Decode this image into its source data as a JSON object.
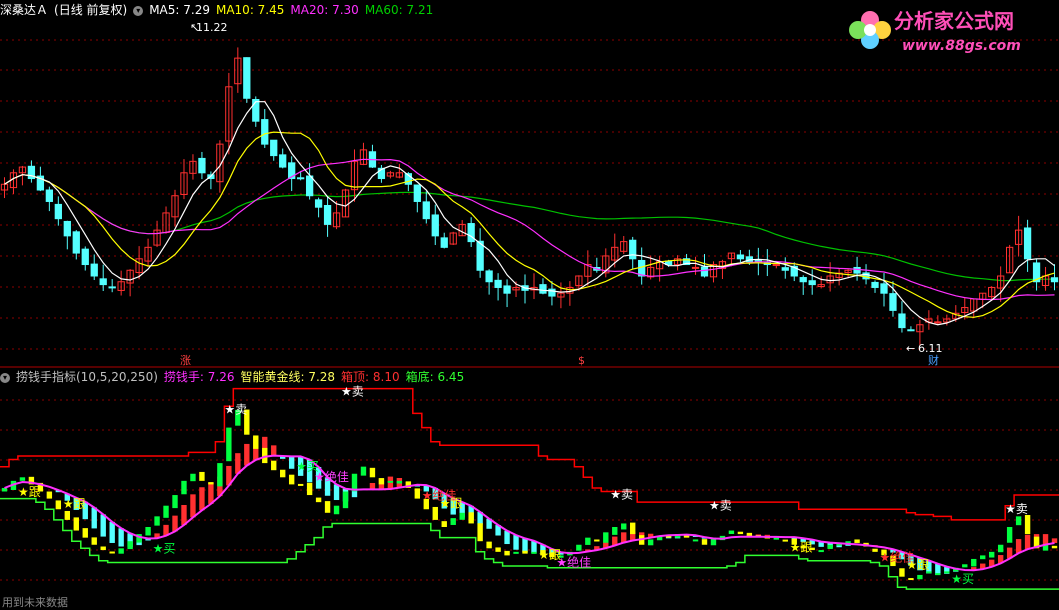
{
  "top_header": {
    "stock_name": "深桑达Ａ",
    "period": "(日线 前复权)",
    "ma5": "MA5: 7.29",
    "ma10": "MA10: 7.45",
    "ma20": "MA20: 7.30",
    "ma60": "MA60: 7.21"
  },
  "bottom_header": {
    "indicator_name": "捞钱手指标(10,5,20,250)",
    "lqs": "捞钱手: 7.26",
    "gold_line": "智能黄金线: 7.28",
    "box_top": "箱顶: 8.10",
    "box_bottom": "箱底: 6.45"
  },
  "watermark": {
    "title": "分析家公式网",
    "url": "www.88gs.com"
  },
  "markers": {
    "high_price": "11.22",
    "low_price": "6.11",
    "zhang": "涨",
    "dollar": "$",
    "cai": "财"
  },
  "signals": {
    "sell": "卖",
    "follow": "跟",
    "buy": "买",
    "absolute": "绝佳"
  },
  "footer_note": "用到未来数据",
  "colors": {
    "up": "#ff3030",
    "down": "#54ffff",
    "ma5": "#ffffff",
    "ma10": "#ffff00",
    "ma20": "#ff30ff",
    "ma60": "#00c000",
    "box_top": "#ff0000",
    "box_bottom": "#30ff30",
    "grid": "#8b0000"
  },
  "chart_data": {
    "type": "candlestick",
    "price_ylim": [
      5.6,
      11.6
    ],
    "closes": [
      8.7,
      8.9,
      9.0,
      8.8,
      8.6,
      8.4,
      8.1,
      7.8,
      7.5,
      7.3,
      7.1,
      6.95,
      6.9,
      7.0,
      7.2,
      7.4,
      7.6,
      7.9,
      8.2,
      8.5,
      8.9,
      9.1,
      8.9,
      8.8,
      9.4,
      10.4,
      10.9,
      10.2,
      9.8,
      9.4,
      9.2,
      9.0,
      8.8,
      8.8,
      8.5,
      8.3,
      8.0,
      8.2,
      8.6,
      9.1,
      9.3,
      9.0,
      8.8,
      8.9,
      8.9,
      8.7,
      8.4,
      8.1,
      7.8,
      7.6,
      7.85,
      8.0,
      7.7,
      7.2,
      7.0,
      6.9,
      6.8,
      6.9,
      6.85,
      6.9,
      6.8,
      6.75,
      6.8,
      6.9,
      7.1,
      7.3,
      7.2,
      7.45,
      7.6,
      7.7,
      7.4,
      7.1,
      7.25,
      7.35,
      7.3,
      7.4,
      7.3,
      7.25,
      7.1,
      7.3,
      7.35,
      7.5,
      7.4,
      7.35,
      7.35,
      7.3,
      7.3,
      7.2,
      7.1,
      7.0,
      6.95,
      6.95,
      7.1,
      7.15,
      7.2,
      7.15,
      7.05,
      6.9,
      6.8,
      6.5,
      6.2,
      6.15,
      6.25,
      6.35,
      6.3,
      6.35,
      6.45,
      6.55,
      6.7,
      6.8,
      6.9,
      7.1,
      7.6,
      7.9,
      7.4,
      7.0,
      7.1,
      7.0
    ],
    "high_marker": 11.22,
    "low_marker": 6.11,
    "ma_values": {
      "ma5": 7.29,
      "ma10": 7.45,
      "ma20": 7.3,
      "ma60": 7.21
    },
    "indicator": {
      "lqs": 7.26,
      "gold_line": 7.28,
      "box_top": 8.1,
      "box_bottom": 6.45
    }
  }
}
